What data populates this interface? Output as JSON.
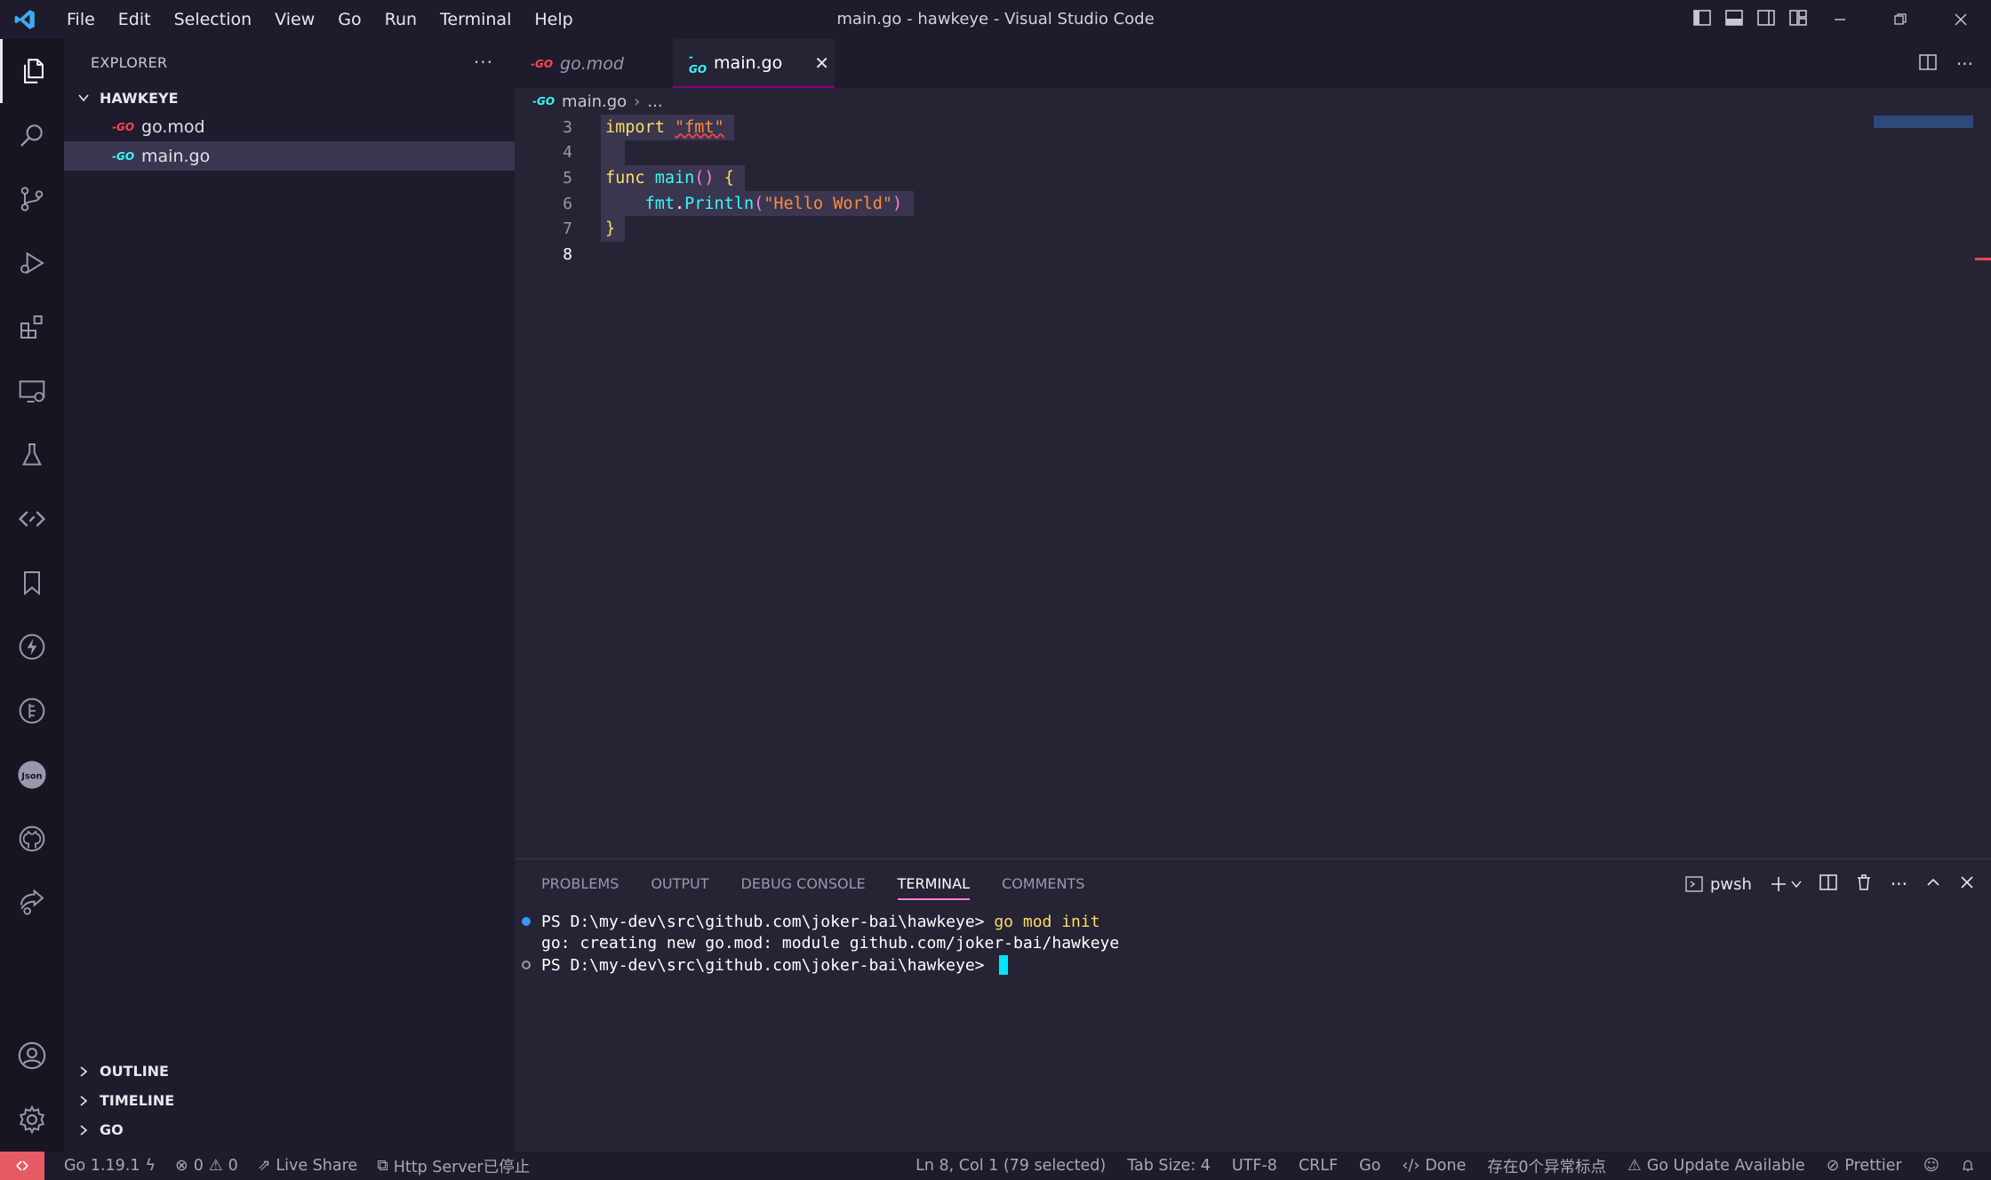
{
  "window": {
    "title": "main.go - hawkeye - Visual Studio Code",
    "menu": [
      "File",
      "Edit",
      "Selection",
      "View",
      "Go",
      "Run",
      "Terminal",
      "Help"
    ]
  },
  "activity_bar": {
    "items": [
      "explorer-icon",
      "search-icon",
      "source-control-icon",
      "run-debug-icon",
      "extensions-icon",
      "remote-explorer-icon",
      "testing-icon",
      "live-share-icon",
      "bookmarks-icon",
      "thunder-client-icon",
      "docker-icon",
      "json-icon",
      "github-icon",
      "remote-share-icon"
    ],
    "bottom": [
      "accounts-icon",
      "manage-gear-icon"
    ]
  },
  "sidebar": {
    "header": "EXPLORER",
    "folder": "HAWKEYE",
    "files": [
      {
        "name": "go.mod",
        "icon": "go-red"
      },
      {
        "name": "main.go",
        "icon": "go-cyan"
      }
    ],
    "sections": [
      "OUTLINE",
      "TIMELINE",
      "GO"
    ]
  },
  "editor": {
    "tabs": [
      {
        "label": "go.mod",
        "active": false
      },
      {
        "label": "main.go",
        "active": true
      }
    ],
    "breadcrumb": {
      "file": "main.go",
      "rest": "..."
    },
    "lines": [
      {
        "num": "3",
        "tokens": [
          [
            "kw",
            "import"
          ],
          [
            "pl",
            " "
          ],
          [
            "str",
            "\"fmt\""
          ]
        ]
      },
      {
        "num": "4",
        "tokens": []
      },
      {
        "num": "5",
        "tokens": [
          [
            "kw",
            "func"
          ],
          [
            "pl",
            " "
          ],
          [
            "fn",
            "main"
          ],
          [
            "pk",
            "()"
          ],
          [
            "pl",
            " "
          ],
          [
            "kw",
            "{"
          ]
        ]
      },
      {
        "num": "6",
        "tokens": [
          [
            "pl",
            "    "
          ],
          [
            "fn",
            "fmt"
          ],
          [
            "pl",
            "."
          ],
          [
            "fn",
            "Println"
          ],
          [
            "pk",
            "("
          ],
          [
            "str",
            "\"Hello World\""
          ],
          [
            "pk",
            ")"
          ]
        ]
      },
      {
        "num": "7",
        "tokens": [
          [
            "kw",
            "}"
          ]
        ]
      },
      {
        "num": "8",
        "tokens": []
      }
    ]
  },
  "panel": {
    "tabs": [
      "PROBLEMS",
      "OUTPUT",
      "DEBUG CONSOLE",
      "TERMINAL",
      "COMMENTS"
    ],
    "active_tab": "TERMINAL",
    "shell": "pwsh",
    "terminal": [
      {
        "prompt": "PS D:\\my-dev\\src\\github.com\\joker-bai\\hawkeye> ",
        "cmd": "go mod init",
        "dot": "filled"
      },
      {
        "prompt": "go: creating new go.mod: module github.com/joker-bai/hawkeye",
        "cmd": "",
        "dot": "none"
      },
      {
        "prompt": "PS D:\\my-dev\\src\\github.com\\joker-bai\\hawkeye> ",
        "cmd": "",
        "dot": "hollow"
      }
    ]
  },
  "statusbar": {
    "go_version": "Go 1.19.1",
    "errors": "0",
    "warnings": "0",
    "live_share": "Live Share",
    "http_server": "Http Server已停止",
    "cursor_pos": "Ln 8, Col 1 (79 selected)",
    "tab_size": "Tab Size: 4",
    "encoding": "UTF-8",
    "eol": "CRLF",
    "language": "Go",
    "done": "Done",
    "anomalies": "存在0个异常标点",
    "go_update": "Go Update Available",
    "prettier": "Prettier"
  },
  "colors": {
    "accent_pink": "#ff7edb",
    "keyword": "#fede5d",
    "string": "#ff8b39",
    "function": "#36f9f6",
    "remote": "#e55a63"
  }
}
